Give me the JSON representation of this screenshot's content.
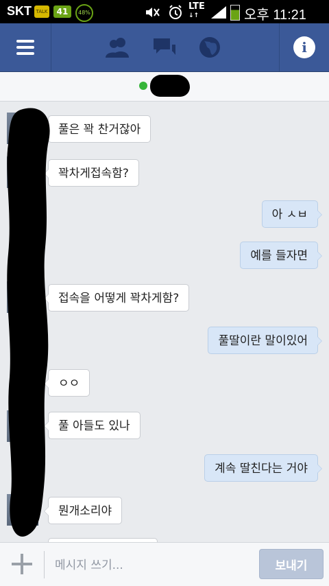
{
  "status_bar": {
    "carrier": "SKT",
    "talk_label": "TALK",
    "badge_count": "41",
    "battery_circle": "48%",
    "network": "LTE",
    "time": "오후 11:21"
  },
  "header": {
    "icons": [
      "menu-icon",
      "friend-requests-icon",
      "messages-icon",
      "notifications-globe-icon",
      "info-icon"
    ],
    "accent_color": "#3b5998"
  },
  "chat": {
    "online_color": "#36b53a",
    "messages": [
      {
        "side": "in",
        "text": "풀은 꽉 찬거잖아"
      },
      {
        "side": "in",
        "text": "꽉차게접속함?"
      },
      {
        "side": "out",
        "text": "아 ㅅㅂ"
      },
      {
        "side": "out",
        "text": "예를 들자면"
      },
      {
        "side": "in",
        "text": "접속을 어떻게 꽉차게함?"
      },
      {
        "side": "out",
        "text": "풀딸이란 말이있어"
      },
      {
        "side": "in",
        "text": "ㅇㅇ"
      },
      {
        "side": "in",
        "text": "풀 아들도 있나"
      },
      {
        "side": "out",
        "text": "계속 딸친다는 거야"
      },
      {
        "side": "in",
        "text": "뭔개소리야"
      }
    ]
  },
  "composer": {
    "placeholder": "메시지 쓰기...",
    "send_label": "보내기"
  }
}
